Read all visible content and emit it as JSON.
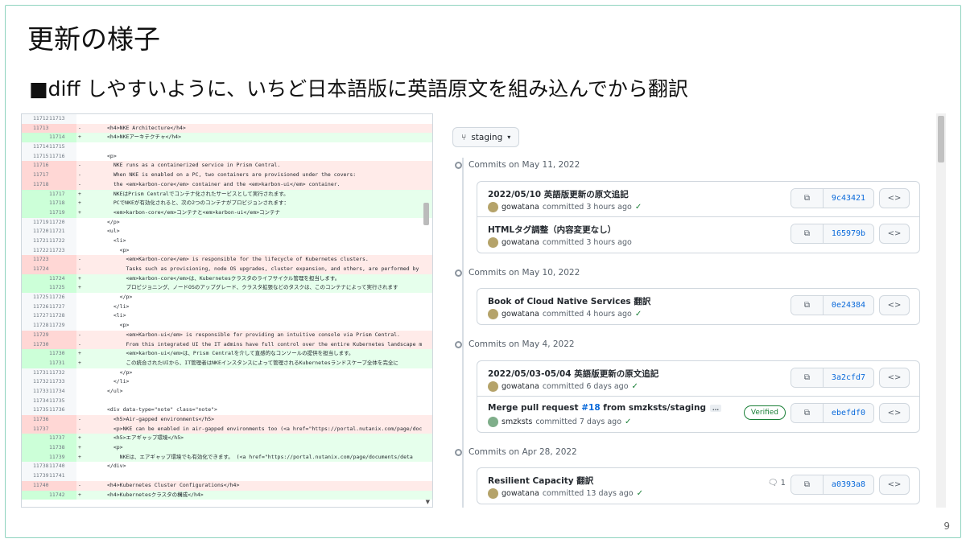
{
  "slide": {
    "title": "更新の様子",
    "bullet": "■diff しやすいように、いちど日本語版に英語原文を組み込んでから翻訳",
    "page_number": "9"
  },
  "diff": {
    "rows": [
      {
        "type": "ctx",
        "old": "11712",
        "new": "11713",
        "sign": "",
        "code": ""
      },
      {
        "type": "del",
        "old": "11713",
        "new": "",
        "sign": "-",
        "code": "<h4>NKE Architecture</h4>"
      },
      {
        "type": "add",
        "old": "",
        "new": "11714",
        "sign": "+",
        "code": "<h4>NKEアーキテクチャ</h4>"
      },
      {
        "type": "ctx",
        "old": "11714",
        "new": "11715",
        "sign": "",
        "code": ""
      },
      {
        "type": "ctx",
        "old": "11715",
        "new": "11716",
        "sign": "",
        "code": "<p>"
      },
      {
        "type": "del",
        "old": "11716",
        "new": "",
        "sign": "-",
        "code": "  NKE runs as a containerized service in Prism Central."
      },
      {
        "type": "del",
        "old": "11717",
        "new": "",
        "sign": "-",
        "code": "  When NKE is enabled on a PC, two containers are provisioned under the covers:"
      },
      {
        "type": "del",
        "old": "11718",
        "new": "",
        "sign": "-",
        "code": "  the <em>karbon-core</em> container and the <em>karbon-ui</em> container."
      },
      {
        "type": "add",
        "old": "",
        "new": "11717",
        "sign": "+",
        "code": "  NKEはPrism Centralでコンテナ化されたサービスとして実行されます。"
      },
      {
        "type": "add",
        "old": "",
        "new": "11718",
        "sign": "+",
        "code": "  PCでNKEが有効化されると、次の2つのコンテナがプロビジョンされます："
      },
      {
        "type": "add",
        "old": "",
        "new": "11719",
        "sign": "+",
        "code": "  <em>karbon-core</em>コンテナと<em>karbon-ui</em>コンテナ"
      },
      {
        "type": "ctx",
        "old": "11719",
        "new": "11720",
        "sign": "",
        "code": "</p>"
      },
      {
        "type": "ctx",
        "old": "11720",
        "new": "11721",
        "sign": "",
        "code": "<ul>"
      },
      {
        "type": "ctx",
        "old": "11721",
        "new": "11722",
        "sign": "",
        "code": "  <li>"
      },
      {
        "type": "ctx",
        "old": "11722",
        "new": "11723",
        "sign": "",
        "code": "    <p>"
      },
      {
        "type": "del",
        "old": "11723",
        "new": "",
        "sign": "-",
        "code": "      <em>Karbon-core</em> is responsible for the lifecycle of Kubernetes clusters."
      },
      {
        "type": "del",
        "old": "11724",
        "new": "",
        "sign": "-",
        "code": "      Tasks such as provisioning, node OS upgrades, cluster expansion, and others, are performed by"
      },
      {
        "type": "add",
        "old": "",
        "new": "11724",
        "sign": "+",
        "code": "      <em>karbon-core</em>は、Kubernetesクラスタのライフサイクル管理を担当します。"
      },
      {
        "type": "add",
        "old": "",
        "new": "11725",
        "sign": "+",
        "code": "      プロビジョニング、ノードOSのアップグレード、クラスタ拡張などのタスクは、このコンテナによって実行されます"
      },
      {
        "type": "ctx",
        "old": "11725",
        "new": "11726",
        "sign": "",
        "code": "    </p>"
      },
      {
        "type": "ctx",
        "old": "11726",
        "new": "11727",
        "sign": "",
        "code": "  </li>"
      },
      {
        "type": "ctx",
        "old": "11727",
        "new": "11728",
        "sign": "",
        "code": "  <li>"
      },
      {
        "type": "ctx",
        "old": "11728",
        "new": "11729",
        "sign": "",
        "code": "    <p>"
      },
      {
        "type": "del",
        "old": "11729",
        "new": "",
        "sign": "-",
        "code": "      <em>Karbon-ui</em> is responsible for providing an intuitive console via Prism Central."
      },
      {
        "type": "del",
        "old": "11730",
        "new": "",
        "sign": "-",
        "code": "      From this integrated UI the IT admins have full control over the entire Kubernetes landscape m"
      },
      {
        "type": "add",
        "old": "",
        "new": "11730",
        "sign": "+",
        "code": "      <em>karbon-ui</em>は、Prism Centralを介して直感的なコンソールの提供を担当します。"
      },
      {
        "type": "add",
        "old": "",
        "new": "11731",
        "sign": "+",
        "code": "      この統合されたUIから、IT管理者はNKEインスタンスによって管理されるKubernetesランドスケープ全体を完全に"
      },
      {
        "type": "ctx",
        "old": "11731",
        "new": "11732",
        "sign": "",
        "code": "    </p>"
      },
      {
        "type": "ctx",
        "old": "11732",
        "new": "11733",
        "sign": "",
        "code": "  </li>"
      },
      {
        "type": "ctx",
        "old": "11733",
        "new": "11734",
        "sign": "",
        "code": "</ul>"
      },
      {
        "type": "ctx",
        "old": "11734",
        "new": "11735",
        "sign": "",
        "code": ""
      },
      {
        "type": "ctx",
        "old": "11735",
        "new": "11736",
        "sign": "",
        "code": "<div data-type=\"note\" class=\"note\">"
      },
      {
        "type": "del",
        "old": "11736",
        "new": "",
        "sign": "-",
        "code": "  <h5>Air-gapped environments</h5>"
      },
      {
        "type": "del",
        "old": "11737",
        "new": "",
        "sign": "-",
        "code": "  <p>NKE can be enabled in air-gapped environments too (<a href=\"https://portal.nutanix.com/page/doc"
      },
      {
        "type": "add",
        "old": "",
        "new": "11737",
        "sign": "+",
        "code": "  <h5>エアギャップ環境</h5>"
      },
      {
        "type": "add",
        "old": "",
        "new": "11738",
        "sign": "+",
        "code": "  <p>"
      },
      {
        "type": "add",
        "old": "",
        "new": "11739",
        "sign": "+",
        "code": "    NKEは、エアギャップ環境でも有効化できます。 (<a href=\"https://portal.nutanix.com/page/documents/deta"
      },
      {
        "type": "ctx",
        "old": "11738",
        "new": "11740",
        "sign": "",
        "code": "</div>"
      },
      {
        "type": "ctx",
        "old": "11739",
        "new": "11741",
        "sign": "",
        "code": ""
      },
      {
        "type": "del",
        "old": "11740",
        "new": "",
        "sign": "-",
        "code": "<h4>Kubernetes Cluster Configurations</h4>"
      },
      {
        "type": "add",
        "old": "",
        "new": "11742",
        "sign": "+",
        "code": "<h4>Kubernetesクラスタの構成</h4>"
      }
    ]
  },
  "commits": {
    "branch": "staging",
    "groups": [
      {
        "heading": "Commits on May 11, 2022",
        "items": [
          {
            "message": "2022/05/10 英語版更新の原文追記",
            "author": "gowatana",
            "time": "committed 3 hours ago",
            "sha": "9c43421"
          },
          {
            "message": "HTMLタグ調整（内容変更なし）",
            "author": "gowatana",
            "time": "committed 3 hours ago",
            "sha": "165979b"
          }
        ]
      },
      {
        "heading": "Commits on May 10, 2022",
        "items": [
          {
            "message": "Book of Cloud Native Services 翻訳",
            "author": "gowatana",
            "time": "committed 4 hours ago",
            "sha": "0e24384"
          }
        ]
      },
      {
        "heading": "Commits on May 4, 2022",
        "items": [
          {
            "message": "2022/05/03-05/04 英語版更新の原文追記",
            "author": "gowatana",
            "time": "committed 6 days ago",
            "sha": "3a2cfd7"
          },
          {
            "message_pre": "Merge pull request ",
            "pr": "#18",
            "message_post": " from smzksts/staging",
            "ellipsis": "…",
            "author": "smzksts",
            "time": "committed 7 days ago",
            "sha": "ebefdf0",
            "verified": "Verified"
          }
        ]
      },
      {
        "heading": "Commits on Apr 28, 2022",
        "items": [
          {
            "message": "Resilient Capacity 翻訳",
            "author": "gowatana",
            "time": "committed 13 days ago",
            "sha": "a0393a8",
            "comments": "1"
          }
        ]
      }
    ]
  }
}
